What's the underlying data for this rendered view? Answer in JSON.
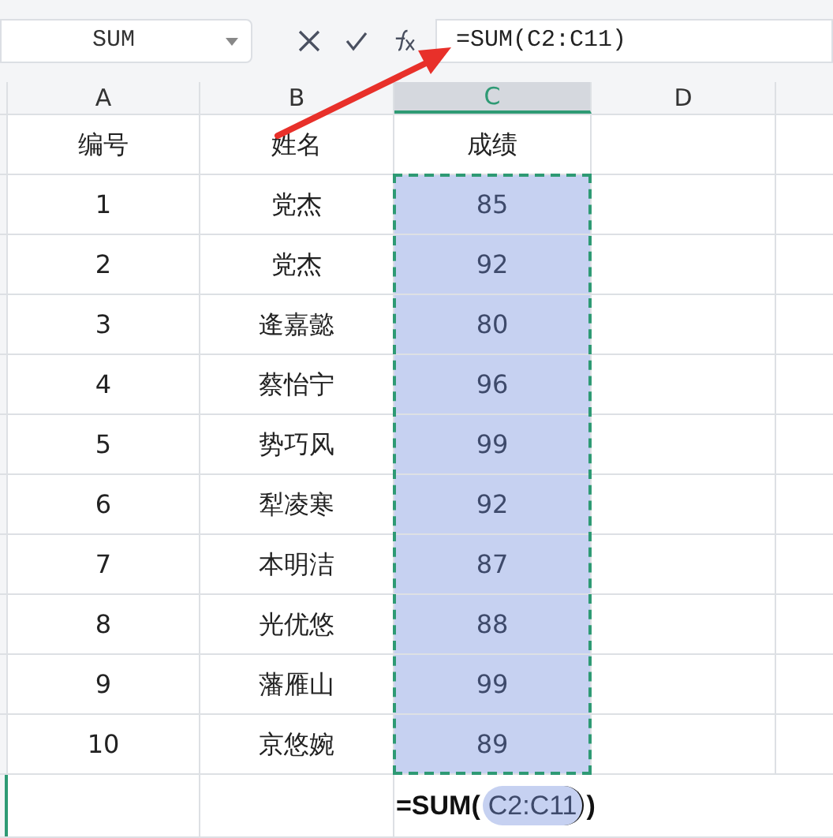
{
  "name_box": {
    "value": "SUM"
  },
  "formula_bar": {
    "value": "=SUM(C2:C11)"
  },
  "columns": [
    {
      "label": "A",
      "selected": false
    },
    {
      "label": "B",
      "selected": false
    },
    {
      "label": "C",
      "selected": true
    },
    {
      "label": "D",
      "selected": false
    }
  ],
  "rows": [
    {
      "cells": [
        "编号",
        "姓名",
        "成绩"
      ],
      "in_range": false
    },
    {
      "cells": [
        "1",
        "党杰",
        "85"
      ],
      "in_range": true
    },
    {
      "cells": [
        "2",
        "党杰",
        "92"
      ],
      "in_range": true
    },
    {
      "cells": [
        "3",
        "逄嘉懿",
        "80"
      ],
      "in_range": true
    },
    {
      "cells": [
        "4",
        "蔡怡宁",
        "96"
      ],
      "in_range": true
    },
    {
      "cells": [
        "5",
        "势巧风",
        "99"
      ],
      "in_range": true
    },
    {
      "cells": [
        "6",
        "犁凌寒",
        "92"
      ],
      "in_range": true
    },
    {
      "cells": [
        "7",
        "本明洁",
        "87"
      ],
      "in_range": true
    },
    {
      "cells": [
        "8",
        "光优悠",
        "88"
      ],
      "in_range": true
    },
    {
      "cells": [
        "9",
        "藩雁山",
        "99"
      ],
      "in_range": true
    },
    {
      "cells": [
        "10",
        "京悠婉",
        "89"
      ],
      "in_range": true
    }
  ],
  "editing_cell": {
    "prefix": "=SUM(",
    "reference": "C2:C11",
    "suffix": ")"
  }
}
